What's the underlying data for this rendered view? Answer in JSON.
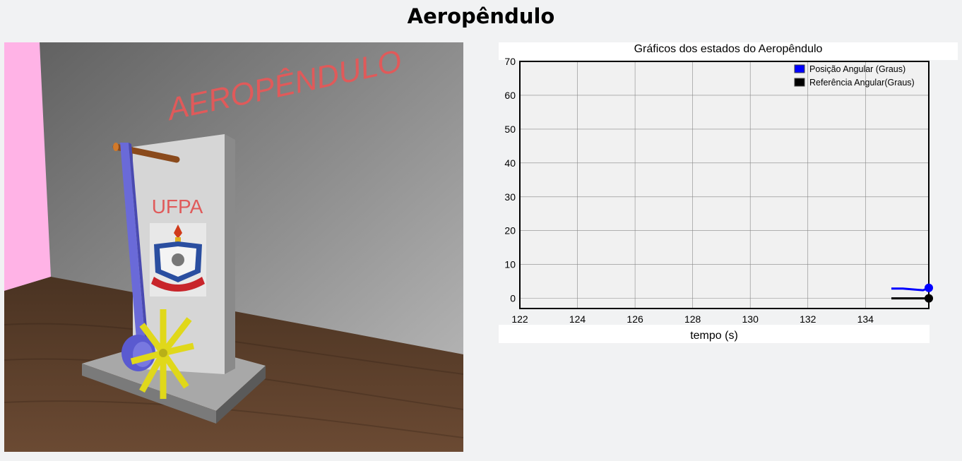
{
  "page": {
    "title": "Aeropêndulo"
  },
  "scene": {
    "wall_text": "AEROPÊNDULO",
    "board_text": "UFPA",
    "colors": {
      "wall": "#9a9a9a",
      "left_wall": "#ffb3e6",
      "table": "#6b4a33",
      "board": "#d6d6d6",
      "pendulum_arm": "#6a6ad8",
      "propeller": "#e0d81a",
      "wall_text": "#e05a5a"
    }
  },
  "chart_data": {
    "type": "line",
    "title": "Gráficos dos estados do Aeropêndulo",
    "xlabel": "tempo (s)",
    "ylabel": "",
    "xlim": [
      122,
      136.2
    ],
    "ylim": [
      -3,
      70
    ],
    "x_ticks": [
      122,
      124,
      126,
      128,
      130,
      132,
      134
    ],
    "y_ticks": [
      0,
      10,
      20,
      30,
      40,
      50,
      60,
      70
    ],
    "grid": true,
    "legend_position": "top-right",
    "series": [
      {
        "name": "Posição Angular (Graus)",
        "color": "#0000ff",
        "x": [
          134.9,
          135.3,
          135.7,
          136.0,
          136.2
        ],
        "y": [
          2.9,
          2.9,
          2.6,
          2.4,
          3.1
        ]
      },
      {
        "name": "Referência Angular(Graus)",
        "color": "#000000",
        "x": [
          134.9,
          135.5,
          136.2
        ],
        "y": [
          0,
          0,
          0
        ]
      }
    ]
  }
}
